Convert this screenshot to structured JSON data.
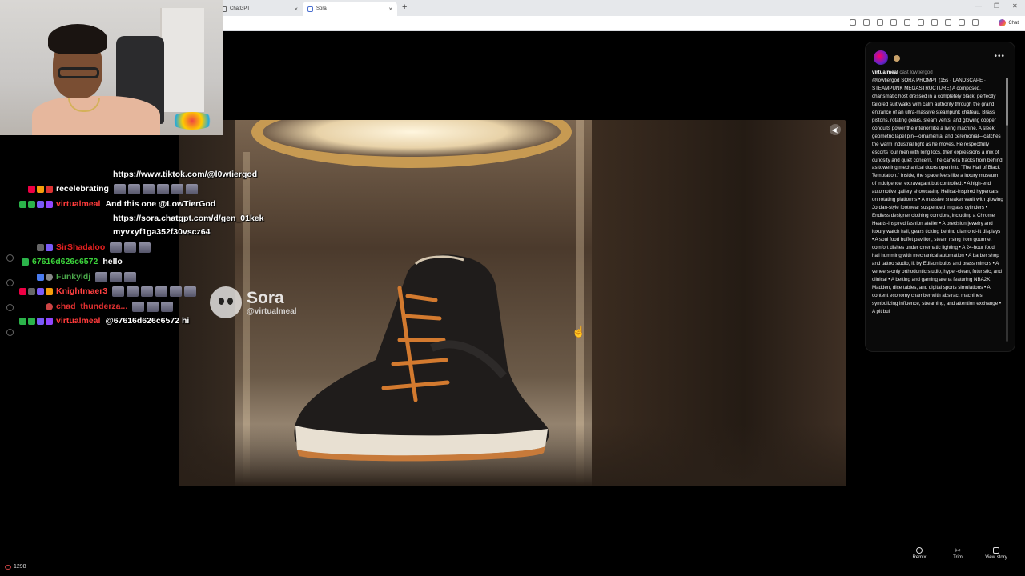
{
  "browser": {
    "tabs": [
      {
        "label": "ChatGPT",
        "close": "×"
      },
      {
        "label": "Sora",
        "close": "×"
      }
    ],
    "new_tab": "+",
    "window_controls": {
      "minimize": "—",
      "maximize": "❐",
      "close": "✕"
    },
    "chat_button": "Chat"
  },
  "chat": {
    "messages": [
      {
        "user": "",
        "user_color": "#ffffff",
        "text": "https://www.tiktok.com/@l0wtiergod",
        "emotes": 0
      },
      {
        "user": "recelebrating",
        "user_color": "#ffffff",
        "text": "",
        "emotes": 6
      },
      {
        "user": "virtualmeal",
        "user_color": "#ff3b3b",
        "text": "And this one @LowTierGod",
        "emotes": 0
      },
      {
        "user": "",
        "user_color": "#ffffff",
        "text": "https://sora.chatgpt.com/d/gen_01kek",
        "emotes": 0
      },
      {
        "user": "",
        "user_color": "#ffffff",
        "text": "myvxyf1ga352f30vscz64",
        "emotes": 0
      },
      {
        "user": "SirShadaloo",
        "user_color": "#e52020",
        "text": "",
        "emotes": 3
      },
      {
        "user": "67616d626c6572",
        "user_color": "#3bd33b",
        "text": "hello",
        "emotes": 0
      },
      {
        "user": "Funkyldj",
        "user_color": "#4aa84a",
        "text": "",
        "emotes": 3
      },
      {
        "user": "Knightmaer3",
        "user_color": "#ff4040",
        "text": "",
        "emotes": 6
      },
      {
        "user": "chad_thunderza...",
        "user_color": "#e03030",
        "text": "",
        "emotes": 3
      },
      {
        "user": "virtualmeal",
        "user_color": "#ff3b3b",
        "text": "@67616d626c6572 hi",
        "emotes": 0
      }
    ],
    "viewer_count": "1298"
  },
  "video": {
    "watermark_name": "Sora",
    "watermark_handle": "@virtualmeal",
    "sound_icon": "speaker-icon"
  },
  "panel": {
    "author": "virtualmeal",
    "cast_label": "cast lowtiergod",
    "more": "•••",
    "description": "@lowtiergod SORA PROMPT (15s · LANDSCAPE · STEAMPUNK MEGASTRUCTURE) A composed, charismatic host dressed in a completely black, perfectly tailored suit walks with calm authority through the grand entrance of an ultra-massive steampunk château. Brass pistons, rotating gears, steam vents, and glowing copper conduits power the interior like a living machine. A sleek geometric lapel pin—ornamental and ceremonial—catches the warm industrial light as he moves. He respectfully escorts four men with long locs, their expressions a mix of curiosity and quiet concern. The camera tracks from behind as towering mechanical doors open into \"The Hall of Black Temptation.\" Inside, the space feels like a luxury museum of indulgence, extravagant but controlled: • A high-end automotive gallery showcasing Hellcat-inspired hypercars on rotating platforms • A massive sneaker vault with glowing Jordan-style footwear suspended in glass cylinders • Endless designer clothing corridors, including a Chrome Hearts-inspired fashion atelier • A precision jewelry and luxury watch hall, gears ticking behind diamond-lit displays • A soul food buffet pavilion, steam rising from gourmet comfort dishes under cinematic lighting • A 24-hour food hall humming with mechanical automation • A barber shop and tattoo studio, lit by Edison bulbs and brass mirrors • A veneers-only orthodontic studio, hyper-clean, futuristic, and clinical • A betting and gaming arena featuring NBA2K, Madden, dice tables, and digital sports simulations • A content economy chamber with abstract machines symbolizing influence, streaming, and attention exchange • A pit bull"
  },
  "actions": [
    {
      "label": "Remix",
      "icon": "remix-icon"
    },
    {
      "label": "Trim",
      "icon": "scissors-icon"
    },
    {
      "label": "View story",
      "icon": "story-icon"
    }
  ]
}
